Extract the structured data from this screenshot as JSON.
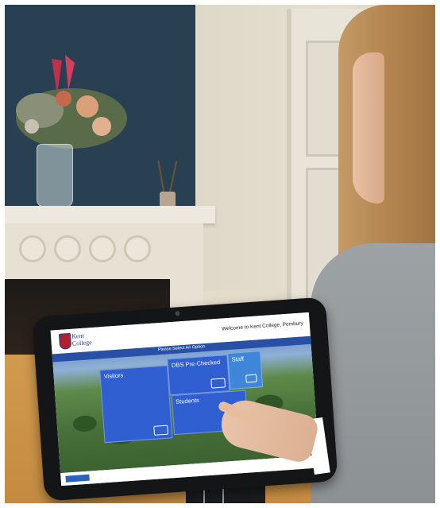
{
  "kiosk": {
    "logo_line1": "Kent",
    "logo_line2": "College",
    "welcome_text": "Welcome to Kent College, Pembury",
    "prompt_text": "Please Select An Option",
    "tiles": [
      {
        "label": "Visitors",
        "icon": "id-card-icon"
      },
      {
        "label": "DBS Pre-Checked",
        "icon": "search-icon"
      },
      {
        "label": "Staff",
        "icon": "staff-icon"
      },
      {
        "label": "Students",
        "icon": "chat-icon"
      }
    ]
  },
  "colors": {
    "tile_blue": "#2f5fd1",
    "header_blue": "#2750a6",
    "wall_navy": "#294052",
    "desk_wood": "#c48b40"
  }
}
